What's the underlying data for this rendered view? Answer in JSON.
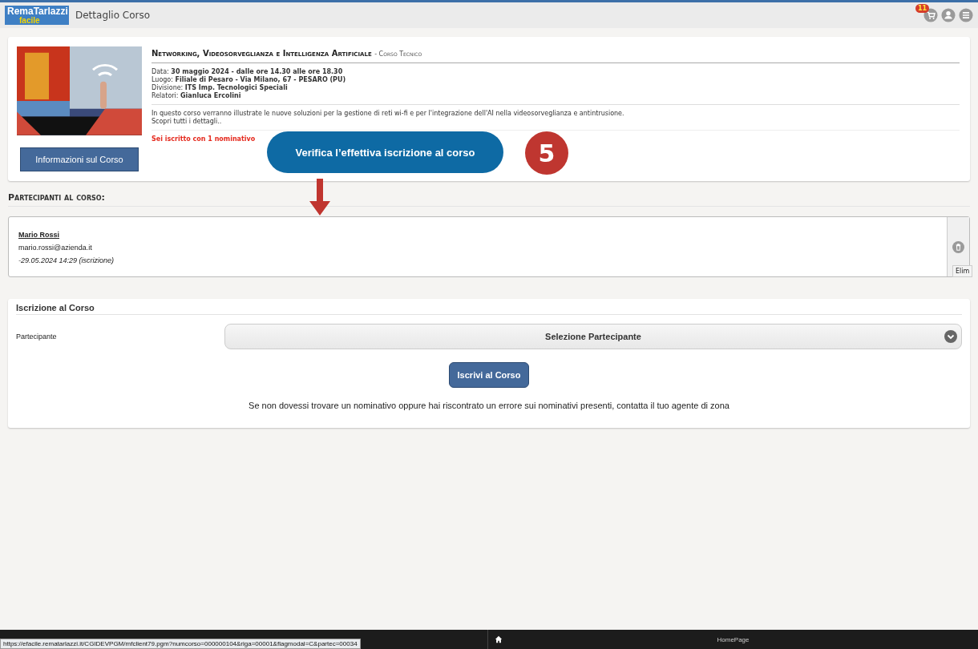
{
  "header": {
    "logo_top": "RemaTarlazzi",
    "logo_bottom": "facile",
    "title": "Dettaglio Corso",
    "cart_badge": "11"
  },
  "course": {
    "title": "Networking, Videosorveglianza e Intelligenza Artificiale",
    "category": "- Corso Tecnico",
    "details": [
      {
        "label": "Data:",
        "value": "30 maggio 2024 - dalle ore 14.30 alle ore 18.30"
      },
      {
        "label": "Luogo:",
        "value": "Filiale di Pesaro - Via Milano, 67 - PESARO (PU)"
      },
      {
        "label": "Divisione:",
        "value": "ITS Imp. Tecnologici Speciali"
      },
      {
        "label": "Relatori:",
        "value": "Gianluca Ercolini"
      }
    ],
    "description": "In questo corso verranno illustrate le nuove soluzioni per la gestione di reti wi-fi e per l'integrazione dell'AI nella videosorveglianza e antintrusione.",
    "more": "Scopri tutti i dettagli..",
    "status": "Sei iscritto con 1 nominativo",
    "info_button": "Informazioni sul Corso"
  },
  "callout": {
    "text": "Verifica l’effettiva iscrizione al corso",
    "step": "5"
  },
  "participants": {
    "heading": "Partecipanti al corso:",
    "items": [
      {
        "name": "Mario Rossi",
        "email": "mario.rossi@azienda.it",
        "date": "-29.05.2024 14:29 (iscrizione)"
      }
    ],
    "tooltip": "Elim"
  },
  "enrollment": {
    "heading": "Iscrizione al Corso",
    "label": "Partecipante",
    "select": "Selezione Partecipante",
    "button": "Iscrivi al Corso",
    "note": "Se non dovessi trovare un nominativo oppure hai riscontrato un errore sui nominativi presenti, contatta il tuo agente di zona"
  },
  "bottom_bar": {
    "url": "https://efacile.rematarlazzi.it/CGIDEVPGM/mfclient79.pgm?numcorso=000000104&riga=00001&flagmodal=C&partec=00034",
    "home": "HomePage"
  }
}
